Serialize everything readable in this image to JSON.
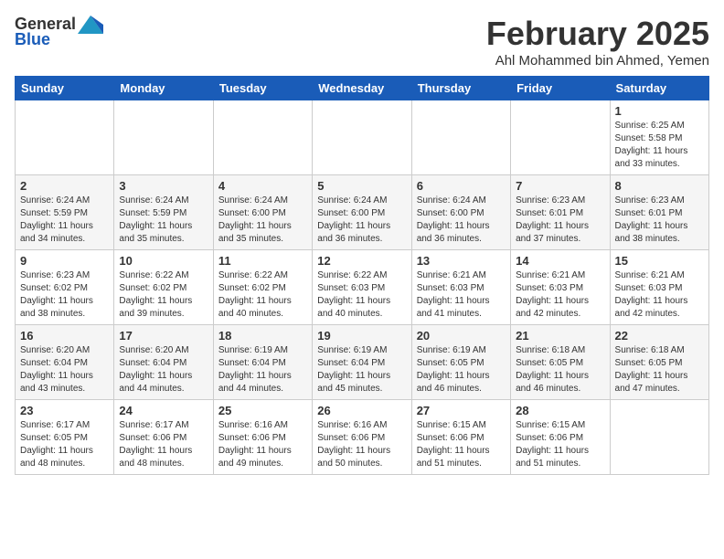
{
  "header": {
    "logo_general": "General",
    "logo_blue": "Blue",
    "month_title": "February 2025",
    "location": "Ahl Mohammed bin Ahmed, Yemen"
  },
  "days_of_week": [
    "Sunday",
    "Monday",
    "Tuesday",
    "Wednesday",
    "Thursday",
    "Friday",
    "Saturday"
  ],
  "weeks": [
    [
      {
        "day": "",
        "info": ""
      },
      {
        "day": "",
        "info": ""
      },
      {
        "day": "",
        "info": ""
      },
      {
        "day": "",
        "info": ""
      },
      {
        "day": "",
        "info": ""
      },
      {
        "day": "",
        "info": ""
      },
      {
        "day": "1",
        "info": "Sunrise: 6:25 AM\nSunset: 5:58 PM\nDaylight: 11 hours\nand 33 minutes."
      }
    ],
    [
      {
        "day": "2",
        "info": "Sunrise: 6:24 AM\nSunset: 5:59 PM\nDaylight: 11 hours\nand 34 minutes."
      },
      {
        "day": "3",
        "info": "Sunrise: 6:24 AM\nSunset: 5:59 PM\nDaylight: 11 hours\nand 35 minutes."
      },
      {
        "day": "4",
        "info": "Sunrise: 6:24 AM\nSunset: 6:00 PM\nDaylight: 11 hours\nand 35 minutes."
      },
      {
        "day": "5",
        "info": "Sunrise: 6:24 AM\nSunset: 6:00 PM\nDaylight: 11 hours\nand 36 minutes."
      },
      {
        "day": "6",
        "info": "Sunrise: 6:24 AM\nSunset: 6:00 PM\nDaylight: 11 hours\nand 36 minutes."
      },
      {
        "day": "7",
        "info": "Sunrise: 6:23 AM\nSunset: 6:01 PM\nDaylight: 11 hours\nand 37 minutes."
      },
      {
        "day": "8",
        "info": "Sunrise: 6:23 AM\nSunset: 6:01 PM\nDaylight: 11 hours\nand 38 minutes."
      }
    ],
    [
      {
        "day": "9",
        "info": "Sunrise: 6:23 AM\nSunset: 6:02 PM\nDaylight: 11 hours\nand 38 minutes."
      },
      {
        "day": "10",
        "info": "Sunrise: 6:22 AM\nSunset: 6:02 PM\nDaylight: 11 hours\nand 39 minutes."
      },
      {
        "day": "11",
        "info": "Sunrise: 6:22 AM\nSunset: 6:02 PM\nDaylight: 11 hours\nand 40 minutes."
      },
      {
        "day": "12",
        "info": "Sunrise: 6:22 AM\nSunset: 6:03 PM\nDaylight: 11 hours\nand 40 minutes."
      },
      {
        "day": "13",
        "info": "Sunrise: 6:21 AM\nSunset: 6:03 PM\nDaylight: 11 hours\nand 41 minutes."
      },
      {
        "day": "14",
        "info": "Sunrise: 6:21 AM\nSunset: 6:03 PM\nDaylight: 11 hours\nand 42 minutes."
      },
      {
        "day": "15",
        "info": "Sunrise: 6:21 AM\nSunset: 6:03 PM\nDaylight: 11 hours\nand 42 minutes."
      }
    ],
    [
      {
        "day": "16",
        "info": "Sunrise: 6:20 AM\nSunset: 6:04 PM\nDaylight: 11 hours\nand 43 minutes."
      },
      {
        "day": "17",
        "info": "Sunrise: 6:20 AM\nSunset: 6:04 PM\nDaylight: 11 hours\nand 44 minutes."
      },
      {
        "day": "18",
        "info": "Sunrise: 6:19 AM\nSunset: 6:04 PM\nDaylight: 11 hours\nand 44 minutes."
      },
      {
        "day": "19",
        "info": "Sunrise: 6:19 AM\nSunset: 6:04 PM\nDaylight: 11 hours\nand 45 minutes."
      },
      {
        "day": "20",
        "info": "Sunrise: 6:19 AM\nSunset: 6:05 PM\nDaylight: 11 hours\nand 46 minutes."
      },
      {
        "day": "21",
        "info": "Sunrise: 6:18 AM\nSunset: 6:05 PM\nDaylight: 11 hours\nand 46 minutes."
      },
      {
        "day": "22",
        "info": "Sunrise: 6:18 AM\nSunset: 6:05 PM\nDaylight: 11 hours\nand 47 minutes."
      }
    ],
    [
      {
        "day": "23",
        "info": "Sunrise: 6:17 AM\nSunset: 6:05 PM\nDaylight: 11 hours\nand 48 minutes."
      },
      {
        "day": "24",
        "info": "Sunrise: 6:17 AM\nSunset: 6:06 PM\nDaylight: 11 hours\nand 48 minutes."
      },
      {
        "day": "25",
        "info": "Sunrise: 6:16 AM\nSunset: 6:06 PM\nDaylight: 11 hours\nand 49 minutes."
      },
      {
        "day": "26",
        "info": "Sunrise: 6:16 AM\nSunset: 6:06 PM\nDaylight: 11 hours\nand 50 minutes."
      },
      {
        "day": "27",
        "info": "Sunrise: 6:15 AM\nSunset: 6:06 PM\nDaylight: 11 hours\nand 51 minutes."
      },
      {
        "day": "28",
        "info": "Sunrise: 6:15 AM\nSunset: 6:06 PM\nDaylight: 11 hours\nand 51 minutes."
      },
      {
        "day": "",
        "info": ""
      }
    ]
  ]
}
